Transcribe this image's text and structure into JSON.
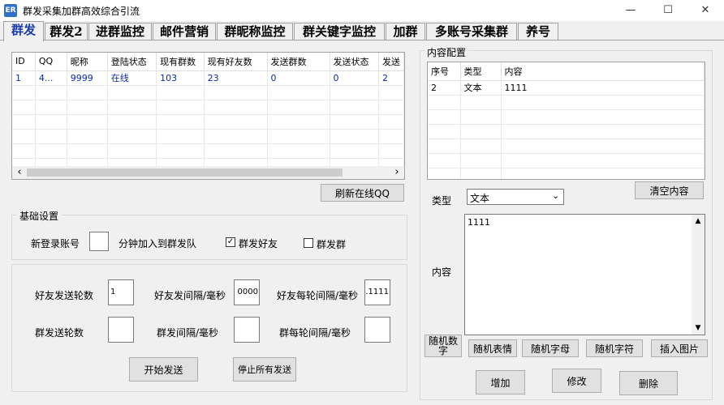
{
  "window": {
    "icon_text": "ER",
    "title": "群发采集加群高效综合引流",
    "min_label": "—",
    "max_label": "☐",
    "close_label": "✕"
  },
  "tabs": [
    {
      "label": "群发",
      "active": true
    },
    {
      "label": "群发2"
    },
    {
      "label": "进群监控"
    },
    {
      "label": "邮件营销"
    },
    {
      "label": "群昵称监控"
    },
    {
      "label": "群关键字监控"
    },
    {
      "label": "加群"
    },
    {
      "label": "多账号采集群"
    },
    {
      "label": "养号"
    }
  ],
  "accounts_table": {
    "columns": [
      "ID",
      "QQ",
      "昵称",
      "登陆状态",
      "现有群数",
      "现有好友数",
      "发送群数",
      "发送状态",
      "发送"
    ],
    "rows": [
      [
        "1",
        "4...",
        "9999",
        "在线",
        "103",
        "23",
        "0",
        "0",
        "2"
      ]
    ],
    "scroll_left": "‹",
    "scroll_right": "›"
  },
  "refresh_button": "刷新在线QQ",
  "basic_settings": {
    "title": "基础设置",
    "new_login_label": "新登录账号",
    "new_login_value": "",
    "minutes_label": "分钟加入到群发队",
    "friends_check_label": "群发好友",
    "friends_checked": true,
    "groups_check_label": "群发群",
    "groups_checked": false
  },
  "send_settings": {
    "friend_rounds_label": "好友发送轮数",
    "friend_rounds_value": "1",
    "friend_interval_label": "好友发间隔/毫秒",
    "friend_interval_value": "0000",
    "friend_round_interval_label": "好友每轮间隔/毫秒",
    "friend_round_interval_value": ".1111",
    "group_rounds_label": "群发送轮数",
    "group_rounds_value": "",
    "group_interval_label": "群发间隔/毫秒",
    "group_interval_value": "",
    "group_round_interval_label": "群每轮间隔/毫秒",
    "group_round_interval_value": ""
  },
  "start_button": "开始发送",
  "stop_button": "停止所有发送",
  "content_config": {
    "title": "内容配置",
    "columns": [
      "序号",
      "类型",
      "内容"
    ],
    "rows": [
      [
        "2",
        "文本",
        "1111"
      ]
    ],
    "clear_button": "清空内容",
    "type_label": "类型",
    "type_value": "文本",
    "content_label": "内容",
    "content_value": "1111",
    "insert_buttons": [
      "随机数字",
      "随机表情",
      "随机字母",
      "随机字符",
      "插入图片"
    ],
    "add_button": "增加",
    "edit_button": "修改",
    "delete_button": "删除"
  }
}
